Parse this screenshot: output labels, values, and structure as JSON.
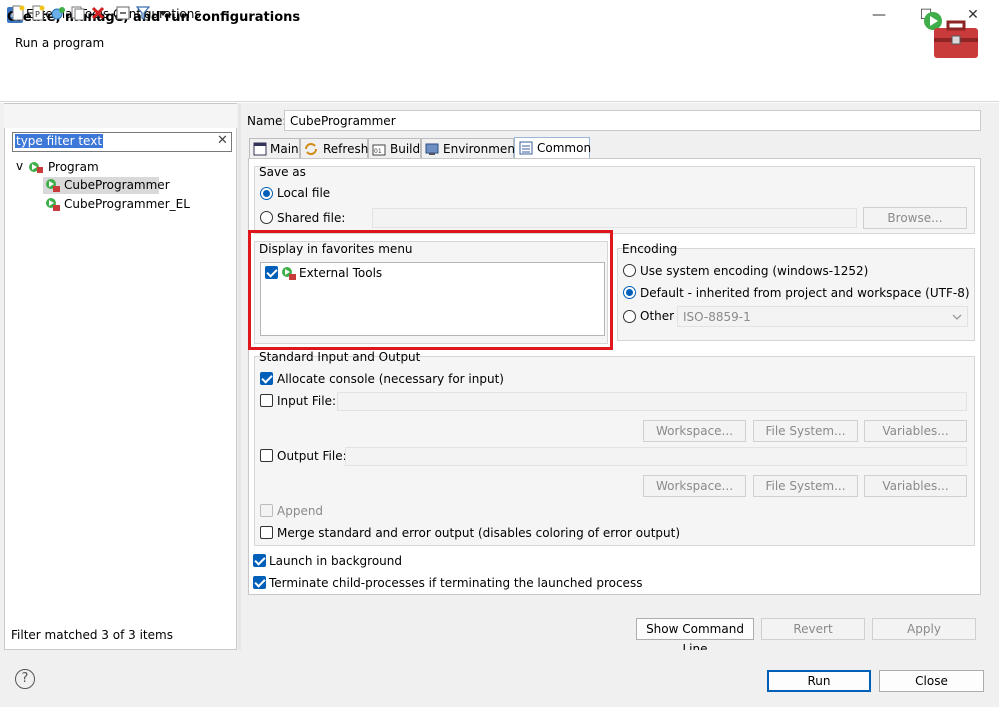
{
  "window": {
    "icon_text": "IDE",
    "title": "External Tools Configurations",
    "controls": {
      "minimize": "—",
      "maximize": "☐",
      "close": "✕"
    }
  },
  "header": {
    "title": "Create, manage, and run configurations",
    "subtitle": "Run a program"
  },
  "left": {
    "filter_placeholder": "type filter text",
    "filter_clear": "✕",
    "tree": {
      "root": {
        "toggle": "v",
        "label": "Program"
      },
      "children": [
        {
          "label": "CubeProgrammer"
        },
        {
          "label": "CubeProgrammer_EL"
        }
      ]
    },
    "status": "Filter matched 3 of 3 items"
  },
  "right": {
    "name_label": "Name:",
    "name_value": "CubeProgrammer",
    "tabs": [
      "Main",
      "Refresh",
      "Build",
      "Environment",
      "Common"
    ],
    "save_as": {
      "title": "Save as",
      "local_file": "Local file",
      "shared_file": "Shared file:",
      "browse": "Browse..."
    },
    "favorites": {
      "title": "Display in favorites menu",
      "item": "External Tools"
    },
    "encoding": {
      "title": "Encoding",
      "system": "Use system encoding (windows-1252)",
      "default": "Default - inherited from project and workspace (UTF-8)",
      "other": "Other",
      "other_value": "ISO-8859-1"
    },
    "stdio": {
      "title": "Standard Input and Output",
      "allocate": "Allocate console (necessary for input)",
      "input_file": "Input File:",
      "output_file": "Output File:",
      "workspace": "Workspace...",
      "file_system": "File System...",
      "variables": "Variables...",
      "append": "Append",
      "merge": "Merge standard and error output (disables coloring of error output)"
    },
    "launch_background": "Launch in background",
    "terminate_children": "Terminate child-processes if terminating the launched process",
    "show_command_line": "Show Command Line",
    "revert": "Revert",
    "apply": "Apply"
  },
  "footer": {
    "help": "?",
    "run": "Run",
    "close": "Close"
  }
}
